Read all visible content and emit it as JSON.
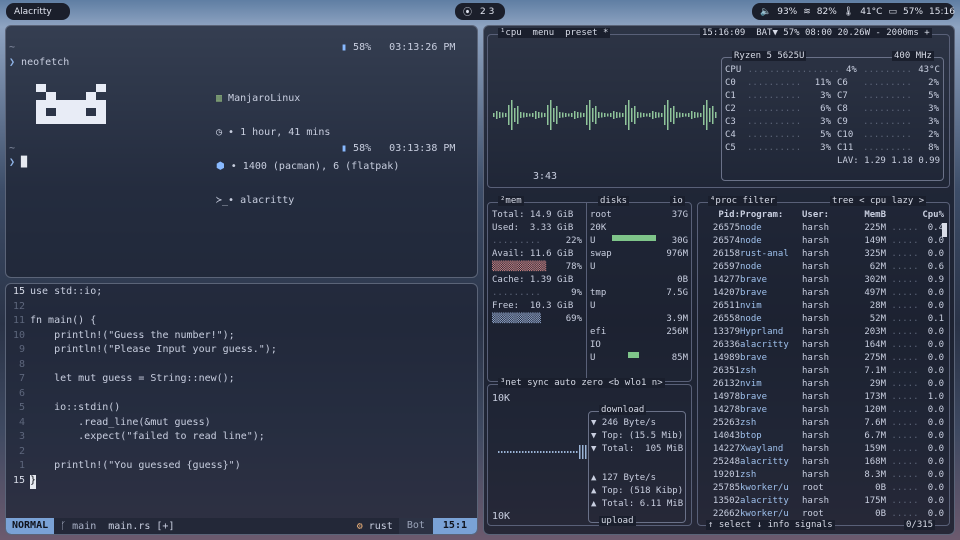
{
  "top": {
    "app": "Alacritty",
    "workspaces": "2  3",
    "status": {
      "volume": "93%",
      "wifi": "82%",
      "temp": "41°C",
      "battery": "57%",
      "time": "15:16"
    }
  },
  "term": {
    "home1": "~",
    "cmd1": "neofetch",
    "bat1": "58%",
    "t1": "03:13:26 PM",
    "info": [
      "ManjaroLinux",
      "• 1 hour, 41 mins",
      "• 1400 (pacman), 6 (flatpak)",
      "• alacritty"
    ],
    "home2": "~",
    "bat2": "58%",
    "t2": "03:13:38 PM",
    "cursor": "█"
  },
  "nvim": {
    "lines": [
      {
        "n": "15",
        "t": "use std::io;"
      },
      {
        "n": "12",
        "t": ""
      },
      {
        "n": "11",
        "t": "fn main() {"
      },
      {
        "n": "10",
        "t": "    println!(\"Guess the number!\");"
      },
      {
        "n": "9",
        "t": "    println!(\"Please Input your guess.\");"
      },
      {
        "n": "8",
        "t": ""
      },
      {
        "n": "7",
        "t": "    let mut guess = String::new();"
      },
      {
        "n": "6",
        "t": ""
      },
      {
        "n": "5",
        "t": "    io::stdin()"
      },
      {
        "n": "4",
        "t": "        .read_line(&mut guess)"
      },
      {
        "n": "3",
        "t": "        .expect(\"failed to read line\");"
      },
      {
        "n": "2",
        "t": ""
      },
      {
        "n": "1",
        "t": "    println!(\"You guessed {guess}\")"
      },
      {
        "n": "15",
        "t": "}"
      }
    ],
    "mode": "NORMAL",
    "branch": "main",
    "file": "main.rs [+]",
    "lang": "rust",
    "pos": "Bot",
    "cursor": "15:1"
  },
  "btop": {
    "cpu_title": "¹cpu",
    "menu": "menu",
    "preset": "preset *",
    "clock": "15:16:09",
    "bat": "BAT▼ 57% 08:00 20.26W",
    "refresh": "- 2000ms +",
    "cpu_model": "Ryzen 5 5625U",
    "freq": "400 MHz",
    "uptime": "3:43",
    "cpu_total": {
      "label": "CPU",
      "pct": "4%",
      "temp": "43°C"
    },
    "cores": [
      [
        "C0",
        "11%",
        "C6",
        "2%"
      ],
      [
        "C1",
        "3%",
        "C7",
        "5%"
      ],
      [
        "C2",
        "6%",
        "C8",
        "3%"
      ],
      [
        "C3",
        "3%",
        "C9",
        "3%"
      ],
      [
        "C4",
        "5%",
        "C10",
        "2%"
      ],
      [
        "C5",
        "3%",
        "C11",
        "8%"
      ]
    ],
    "lav": "LAV: 1.29 1.18 0.99",
    "mem": {
      "title": "²mem",
      "total": "Total: 14.9 GiB",
      "used": "Used:  3.33 GiB",
      "used_pct": "22%",
      "avail": "Avail: 11.6 GiB",
      "avail_pct": "78%",
      "cache": "Cache: 1.39 GiB",
      "cache_pct": "9%",
      "free": "Free:  10.3 GiB",
      "free_pct": "69%"
    },
    "disks": {
      "title": "disks",
      "io": "io",
      "items": [
        {
          "name": "root",
          "size": "37G",
          "s1": "20K",
          "u": "U",
          "val": "30G"
        },
        {
          "name": "swap",
          "size": "976M",
          "s1": "U",
          "u": "",
          "val": "0B"
        },
        {
          "name": "tmp",
          "size": "7.5G",
          "s1": "U",
          "u": "",
          "val": "3.9M"
        },
        {
          "name": "efi",
          "size": "256M",
          "s1": "IO",
          "u": "U",
          "val": "85M"
        }
      ]
    },
    "net": {
      "title": "³net",
      "sync": "sync",
      "auto": "auto",
      "zero": "zero",
      "iface": "<b wlo1 n>",
      "top": "10K",
      "bottom": "10K",
      "download": "download",
      "dl": [
        "▼ 246 Byte/s",
        "▼ Top: (15.5 Mib)",
        "▼ Total:  105 MiB"
      ],
      "ul": [
        "▲ 127 Byte/s",
        "▲ Top: (518 Kibp)",
        "▲ Total: 6.11 MiB"
      ],
      "upload": "upload"
    },
    "proc": {
      "title": "⁴proc",
      "filter": "filter",
      "tree": "tree",
      "mode": "< cpu lazy >",
      "headers": [
        "Pid:",
        "Program:",
        "User:",
        "MemB",
        "Cpu%"
      ],
      "rows": [
        [
          "26575",
          "node",
          "harsh",
          "225M",
          "0.4"
        ],
        [
          "26574",
          "node",
          "harsh",
          "149M",
          "0.0"
        ],
        [
          "26158",
          "rust-anal",
          "harsh",
          "325M",
          "0.0"
        ],
        [
          "26597",
          "node",
          "harsh",
          "62M",
          "0.6"
        ],
        [
          "14277",
          "brave",
          "harsh",
          "302M",
          "0.9"
        ],
        [
          "14207",
          "brave",
          "harsh",
          "497M",
          "0.0"
        ],
        [
          "26511",
          "nvim",
          "harsh",
          "28M",
          "0.0"
        ],
        [
          "26558",
          "node",
          "harsh",
          "52M",
          "0.1"
        ],
        [
          "13379",
          "Hyprland",
          "harsh",
          "203M",
          "0.0"
        ],
        [
          "26336",
          "alacritty",
          "harsh",
          "164M",
          "0.0"
        ],
        [
          "14989",
          "brave",
          "harsh",
          "275M",
          "0.0"
        ],
        [
          "26351",
          "zsh",
          "harsh",
          "7.1M",
          "0.0"
        ],
        [
          "26132",
          "nvim",
          "harsh",
          "29M",
          "0.0"
        ],
        [
          "14978",
          "brave",
          "harsh",
          "173M",
          "1.0"
        ],
        [
          "14278",
          "brave",
          "harsh",
          "120M",
          "0.0"
        ],
        [
          "25263",
          "zsh",
          "harsh",
          "7.6M",
          "0.0"
        ],
        [
          "14043",
          "btop",
          "harsh",
          "6.7M",
          "0.0"
        ],
        [
          "14227",
          "Xwayland",
          "harsh",
          "159M",
          "0.0"
        ],
        [
          "25248",
          "alacritty",
          "harsh",
          "168M",
          "0.0"
        ],
        [
          "19201",
          "zsh",
          "harsh",
          "8.3M",
          "0.0"
        ],
        [
          "25785",
          "kworker/u",
          "root",
          "0B",
          "0.0"
        ],
        [
          "13502",
          "alacritty",
          "harsh",
          "175M",
          "0.0"
        ],
        [
          "22662",
          "kworker/u",
          "root",
          "0B",
          "0.0"
        ]
      ],
      "footer_left": "↑ select ↓",
      "footer_info": "info",
      "footer_signals": "signals",
      "footer_count": "0/315"
    }
  }
}
